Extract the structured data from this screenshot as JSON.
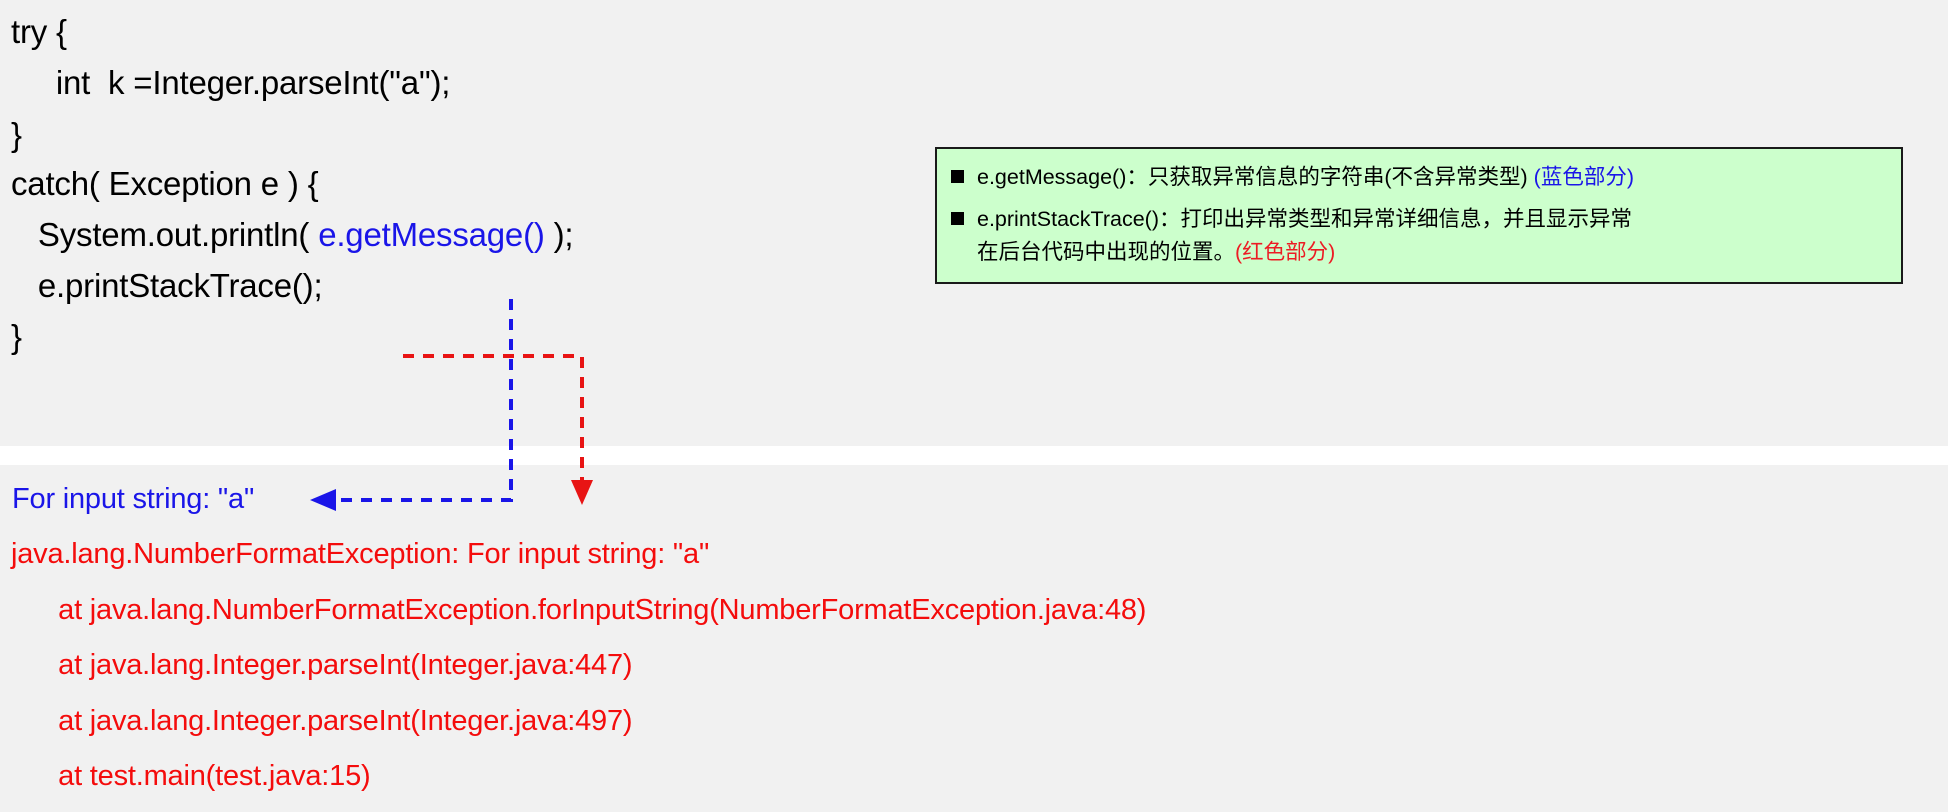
{
  "slide": {
    "background_color": "#f1f1f1",
    "divider_color": "#ffffff"
  },
  "code_block": {
    "lines": [
      {
        "id": "line-try",
        "text": "try {"
      },
      {
        "id": "line-parseint",
        "text": "     int  k =Integer.parseInt(\"a\");"
      },
      {
        "id": "line-close-try",
        "text": "}"
      },
      {
        "id": "line-catch",
        "text": "catch( Exception e ) {"
      },
      {
        "id": "line-println-prefix",
        "text": "   System.out.println( "
      },
      {
        "id": "line-println-call",
        "text": "e.getMessage()"
      },
      {
        "id": "line-println-suffix",
        "text": " );"
      },
      {
        "id": "line-printstack",
        "text": "   e.printStackTrace();"
      },
      {
        "id": "line-close-catch",
        "text": "}"
      }
    ],
    "colors": {
      "default": "#000000",
      "get_message": "#1a15e8",
      "print_stack_trace": "#fc0404"
    }
  },
  "legend": {
    "background_color": "#ccffcc",
    "border_color": "#1a1a1a",
    "bullet": "filled-square",
    "items": [
      {
        "main": "e.getMessage()：只获取异常信息的字符串(不含异常类型) ",
        "tail": "(蓝色部分)",
        "tail_color": "#1a15e8"
      },
      {
        "main": "e.printStackTrace()：打印出异常类型和异常详细信息，并且显示异常",
        "main_second_line": "在后台代码中出现的位置。",
        "tail": "(红色部分)",
        "tail_color": "#ec1c24"
      }
    ]
  },
  "output": {
    "message_line": "For input string: \"a\"",
    "message_color": "#1a15e8",
    "stack_trace_color": "#f40c0c",
    "stack_trace": [
      "java.lang.NumberFormatException: For input string: \"a\"",
      "      at java.lang.NumberFormatException.forInputString(NumberFormatException.java:48)",
      "      at java.lang.Integer.parseInt(Integer.java:447)",
      "      at java.lang.Integer.parseInt(Integer.java:497)",
      "      at test.main(test.java:15)"
    ]
  },
  "arrows": {
    "blue": {
      "color": "#1a15e8",
      "style": "dashed",
      "description": "from e.getMessage() down then left to console message line",
      "head": "left"
    },
    "red": {
      "color": "#e81414",
      "style": "dashed",
      "description": "from e.printStackTrace() right then down to stack trace",
      "head": "down"
    }
  }
}
